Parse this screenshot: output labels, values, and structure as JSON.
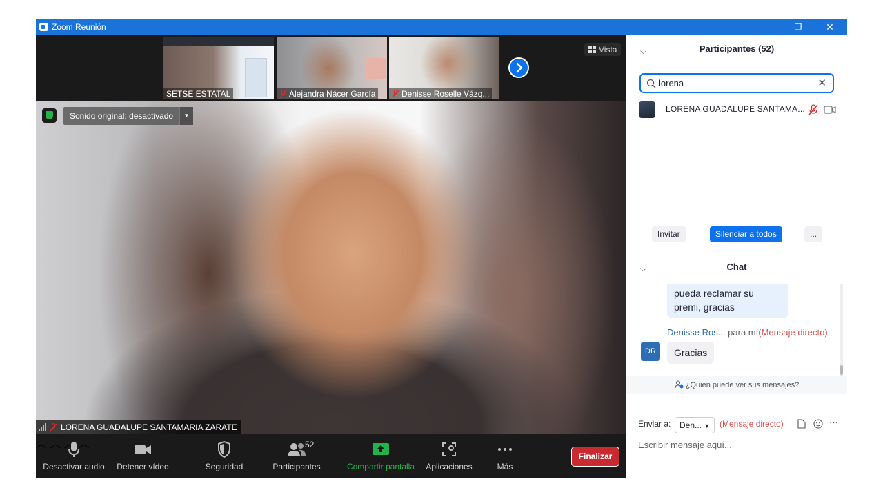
{
  "window": {
    "title": "Zoom Reunión",
    "minimize": "–",
    "restore": "❐",
    "close": "✕"
  },
  "thumbnails": [
    {
      "name": "SETSE ESTATAL",
      "muted": false
    },
    {
      "name": "Alejandra Nácer García",
      "muted": true
    },
    {
      "name": "Denisse Roselle Vázq...",
      "muted": true
    }
  ],
  "view_label": "Vista",
  "sound_original": "Sonido original: desactivado",
  "speaker_name": "LORENA GUADALUPE SANTAMARIA ZARATE",
  "toolbar": {
    "audio": "Desactivar audio",
    "video": "Detener vídeo",
    "security": "Seguridad",
    "participants": "Participantes",
    "participants_count": "52",
    "share": "Compartir pantalla",
    "apps": "Aplicaciones",
    "more": "Más",
    "end": "Finalizar"
  },
  "participants_panel": {
    "title": "Participantes (52)",
    "search_value": "lorena",
    "result_name": "LORENA GUADALUPE SANTAMA...",
    "invite": "Invitar",
    "mute_all": "Silenciar a todos",
    "more": "..."
  },
  "chat": {
    "title": "Chat",
    "prev_message": "pueda reclamar su premi, gracias",
    "sender": "Denisse Ros...",
    "to_me": "para mí",
    "direct": "(Mensaje directo)",
    "avatar_initials": "DR",
    "message": "Gracias",
    "who_sees": "¿Quién puede ver sus mensajes?",
    "send_to_label": "Enviar a:",
    "send_to_value": "Den...",
    "send_to_direct": "(Mensaje directo)",
    "input_placeholder": "Escribir mensaje aquí..."
  },
  "colors": {
    "accent": "#0e72ed",
    "end": "#c92a2f",
    "share": "#23b34b",
    "muted": "#e02828"
  }
}
